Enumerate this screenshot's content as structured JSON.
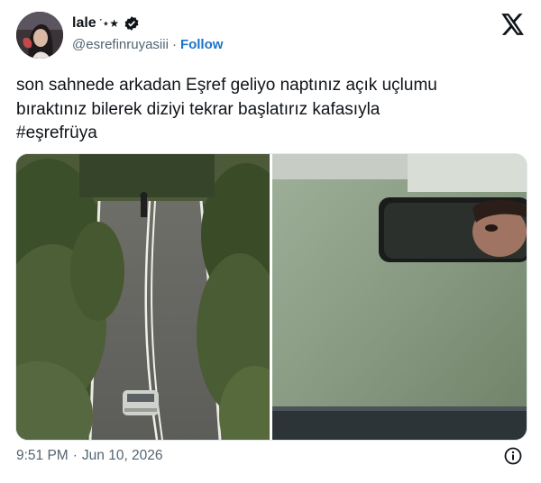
{
  "user": {
    "display_name": "lale",
    "name_decoration": "˙⋆★",
    "handle": "@esrefinruyasiii",
    "separator": "·",
    "follow_label": "Follow"
  },
  "tweet": {
    "text": "son sahnede arkadan Eşref geliyo naptınız açık uçlumu\nbıraktınız bilerek diziyi tekrar başlatırız kafasıyla\n#eşrefrüya"
  },
  "footer": {
    "time": "9:51 PM",
    "separator": "·",
    "date": "Jun 10, 2026"
  },
  "icons": {
    "verified": "verified-badge-icon",
    "x_logo": "x-logo-icon",
    "info": "info-icon"
  },
  "colors": {
    "text": "#0f1419",
    "secondary": "#536471",
    "link": "#1d73c9"
  }
}
